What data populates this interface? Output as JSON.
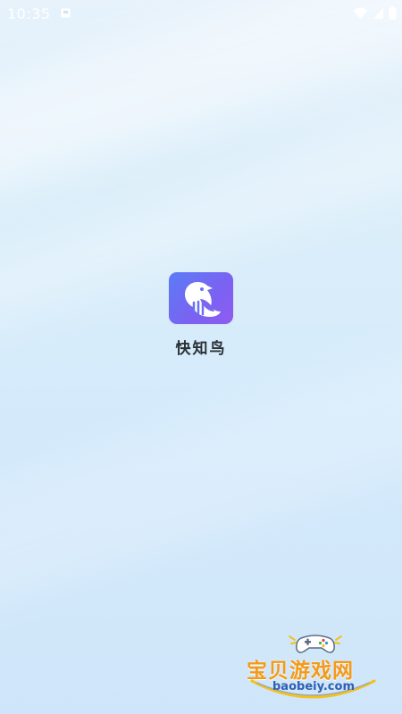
{
  "status_bar": {
    "time": "10:35",
    "icons": [
      "notification-icon",
      "wifi-icon",
      "signal-icon",
      "battery-icon"
    ]
  },
  "app": {
    "name": "快知鸟",
    "icon": "bird-logo-icon",
    "icon_colors": [
      "#5b7cf6",
      "#8f5bf0"
    ]
  },
  "watermark": {
    "title": "宝贝游戏网",
    "url": "baobeiy.com",
    "title_color": "#f39a1a",
    "url_color": "#2f5fb3",
    "icon": "gamepad-icon"
  }
}
